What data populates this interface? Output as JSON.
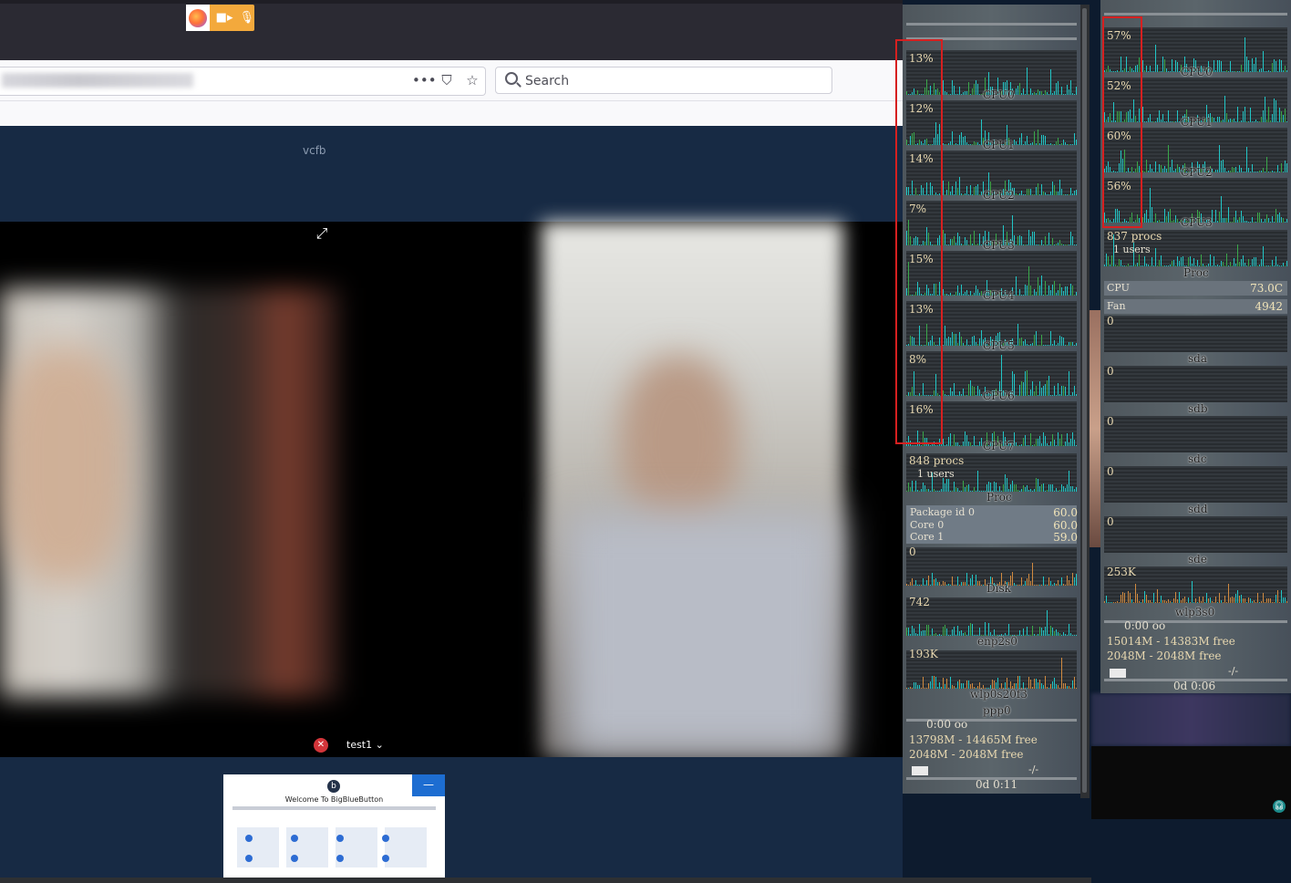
{
  "browser": {
    "menu_icon": "more-horizontal-icon",
    "pocket_icon": "pocket-icon",
    "bookmark_icon": "star-icon",
    "search_placeholder": "Search",
    "share_indicator_icons": [
      "firefox-icon",
      "camera-icon",
      "microphone-icon"
    ]
  },
  "meeting": {
    "room_name": "vcfb",
    "user_label": "test1 ⌄",
    "welcome_title": "Welcome To BigBlueButton",
    "welcome_close": "—"
  },
  "conky_left": {
    "cpus": [
      {
        "name": "CPU0",
        "pct": "13%"
      },
      {
        "name": "CPU1",
        "pct": "12%"
      },
      {
        "name": "CPU2",
        "pct": "14%"
      },
      {
        "name": "CPU3",
        "pct": "7%"
      },
      {
        "name": "CPU4",
        "pct": "15%"
      },
      {
        "name": "CPU5",
        "pct": "13%"
      },
      {
        "name": "CPU6",
        "pct": "8%"
      },
      {
        "name": "CPU7",
        "pct": "16%"
      }
    ],
    "procs": "848 procs",
    "users": "1  users",
    "proc_label": "Proc",
    "sensors": [
      {
        "name": "Package id 0",
        "value": "60.0"
      },
      {
        "name": "Core 0",
        "value": "60.0"
      },
      {
        "name": "Core 1",
        "value": "59.0"
      }
    ],
    "disk_value": "0",
    "disk_label": "Disk",
    "net1_value": "742",
    "net1_label": "enp2s0",
    "net2_value": "193K",
    "net2_label": "wlp0s20f3",
    "ppp_label": "ppp0",
    "ppp_time": "0:00  oo",
    "mem": "13798M - 14465M free",
    "swap": "2048M - 2048M free",
    "mail": "-/-",
    "uptime": "0d  0:11"
  },
  "conky_right": {
    "cpus": [
      {
        "name": "CPU0",
        "pct": "57%"
      },
      {
        "name": "CPU1",
        "pct": "52%"
      },
      {
        "name": "CPU2",
        "pct": "60%"
      },
      {
        "name": "CPU3",
        "pct": "56%"
      }
    ],
    "procs": "837 procs",
    "users": "1  users",
    "proc_label": "Proc",
    "cpu_temp_label": "CPU",
    "cpu_temp": "73.0C",
    "fan_label": "Fan",
    "fan": "4942",
    "disks": [
      {
        "name": "sda",
        "value": "0"
      },
      {
        "name": "sdb",
        "value": "0"
      },
      {
        "name": "sdc",
        "value": "0"
      },
      {
        "name": "sdd",
        "value": "0"
      },
      {
        "name": "sde",
        "value": "0"
      }
    ],
    "net_value": "253K",
    "net_label": "wlp3s0",
    "ppp_time": "0:00  oo",
    "mem": "15014M - 14383M free",
    "swap": "2048M - 2048M free",
    "mail": "-/-",
    "uptime": "0d  0:06"
  }
}
